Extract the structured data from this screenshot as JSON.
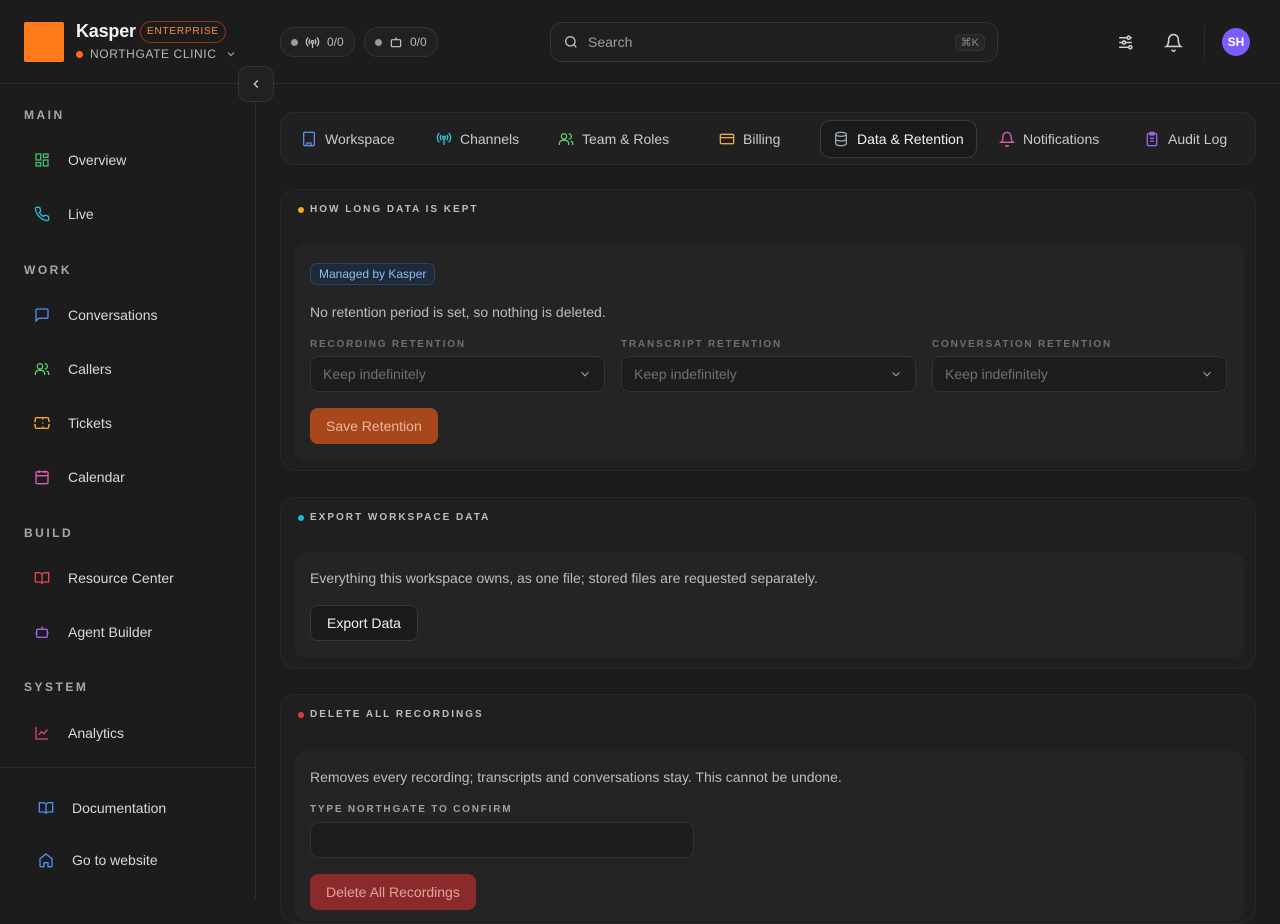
{
  "brand": {
    "name": "Kasper",
    "plan": "ENTERPRISE",
    "org": "NORTHGATE CLINIC"
  },
  "status_pills": [
    {
      "icon": "broadcast-icon",
      "value": "0/0"
    },
    {
      "icon": "bot-icon",
      "value": "0/0"
    }
  ],
  "search": {
    "placeholder": "Search",
    "shortcut": "⌘K"
  },
  "user": {
    "initials": "SH"
  },
  "sidebar": {
    "sections": [
      {
        "title": "MAIN",
        "items": [
          {
            "label": "Overview",
            "icon": "grid-icon"
          },
          {
            "label": "Live",
            "icon": "phone-icon"
          }
        ]
      },
      {
        "title": "WORK",
        "items": [
          {
            "label": "Conversations",
            "icon": "chat-icon"
          },
          {
            "label": "Callers",
            "icon": "users-icon"
          },
          {
            "label": "Tickets",
            "icon": "ticket-icon"
          },
          {
            "label": "Calendar",
            "icon": "calendar-icon"
          }
        ]
      },
      {
        "title": "BUILD",
        "items": [
          {
            "label": "Resource Center",
            "icon": "book-icon"
          },
          {
            "label": "Agent Builder",
            "icon": "bot-icon"
          }
        ]
      },
      {
        "title": "SYSTEM",
        "items": [
          {
            "label": "Analytics",
            "icon": "chart-icon"
          }
        ]
      }
    ],
    "footer": [
      {
        "label": "Documentation",
        "icon": "book-open-icon"
      },
      {
        "label": "Go to website",
        "icon": "home-icon"
      }
    ]
  },
  "tabs": [
    {
      "label": "Workspace",
      "icon": "building-icon",
      "color": "#5b8def"
    },
    {
      "label": "Channels",
      "icon": "antenna-icon",
      "color": "#2ec4d6"
    },
    {
      "label": "Team & Roles",
      "icon": "users-icon",
      "color": "#5ccf6a"
    },
    {
      "label": "Billing",
      "icon": "card-icon",
      "color": "#f2a33a"
    },
    {
      "label": "Data & Retention",
      "icon": "database-icon",
      "color": "#9aa4b2",
      "active": true
    },
    {
      "label": "Notifications",
      "icon": "bell-icon",
      "color": "#e05cb0"
    },
    {
      "label": "Audit Log",
      "icon": "clipboard-icon",
      "color": "#a65cf0"
    }
  ],
  "retention": {
    "heading": "HOW LONG DATA IS KEPT",
    "badge": "Managed by Kasper",
    "description": "No retention period is set, so nothing is deleted.",
    "fields": [
      {
        "label": "RECORDING RETENTION",
        "value": "Keep indefinitely"
      },
      {
        "label": "TRANSCRIPT RETENTION",
        "value": "Keep indefinitely"
      },
      {
        "label": "CONVERSATION RETENTION",
        "value": "Keep indefinitely"
      }
    ],
    "save_label": "Save Retention"
  },
  "export": {
    "heading": "EXPORT WORKSPACE DATA",
    "description": "Everything this workspace owns, as one file; stored files are requested separately.",
    "button_label": "Export Data"
  },
  "delete": {
    "heading": "DELETE ALL RECORDINGS",
    "description": "Removes every recording; transcripts and conversations stay. This cannot be undone.",
    "confirm_label": "TYPE NORTHGATE TO CONFIRM",
    "button_label": "Delete All Recordings"
  },
  "colors": {
    "brand": "#ff7a1a",
    "accent_orange": "#a8461c",
    "danger": "#8a2a2a"
  }
}
